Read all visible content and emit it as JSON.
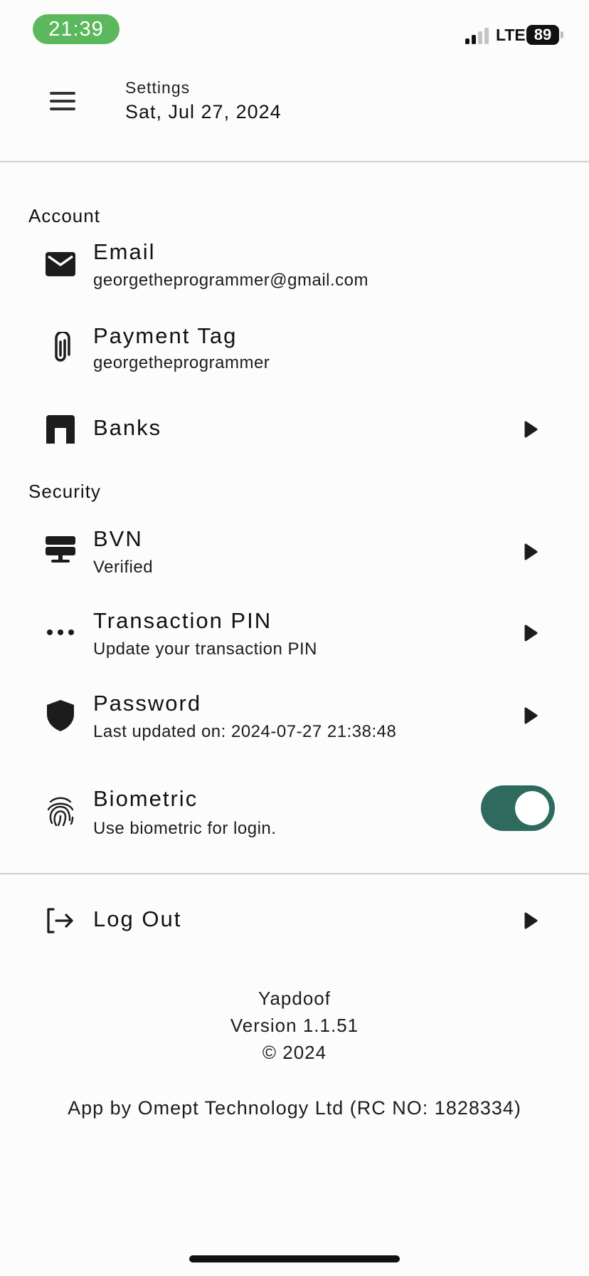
{
  "status_bar": {
    "time": "21:39",
    "network": "LTE",
    "battery": "89"
  },
  "header": {
    "subtitle": "Settings",
    "date": "Sat, Jul 27, 2024"
  },
  "sections": {
    "account": {
      "title": "Account",
      "email": {
        "title": "Email",
        "value": "georgetheprogrammer@gmail.com"
      },
      "payment_tag": {
        "title": "Payment Tag",
        "value": "georgetheprogrammer"
      },
      "banks": {
        "title": "Banks"
      }
    },
    "security": {
      "title": "Security",
      "bvn": {
        "title": "BVN",
        "value": "Verified"
      },
      "transaction_pin": {
        "title": "Transaction PIN",
        "value": "Update your transaction PIN"
      },
      "password": {
        "title": "Password",
        "value": "Last updated on: 2024-07-27 21:38:48"
      },
      "biometric": {
        "title": "Biometric",
        "value": "Use biometric for login.",
        "enabled": true
      }
    }
  },
  "logout": {
    "title": "Log Out"
  },
  "footer": {
    "app_name": "Yapdoof",
    "version": "Version 1.1.51",
    "copyright": "© 2024",
    "credit": "App by Omept Technology Ltd (RC NO: 1828334)"
  },
  "colors": {
    "time_pill": "#5cb85c",
    "toggle_on": "#2e6b5e",
    "background": "#fbfcfb",
    "divider": "#cfcfcf"
  },
  "icons": {
    "menu": "menu-icon",
    "email": "mail-icon",
    "payment_tag": "paperclip-icon",
    "banks": "bank-icon",
    "bvn": "monitor-icon",
    "transaction_pin": "dots-icon",
    "password": "shield-icon",
    "biometric": "fingerprint-icon",
    "logout": "logout-icon",
    "chevron": "play-arrow-icon"
  }
}
